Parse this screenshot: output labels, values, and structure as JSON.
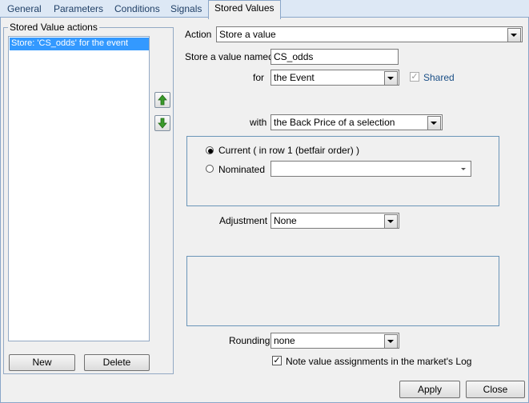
{
  "tabs": [
    {
      "label": "General"
    },
    {
      "label": "Parameters"
    },
    {
      "label": "Conditions"
    },
    {
      "label": "Signals"
    },
    {
      "label": "Stored Values"
    }
  ],
  "stored_actions": {
    "legend": "Stored Value actions",
    "items": [
      "Store: 'CS_odds' for the event"
    ],
    "new_label": "New",
    "delete_label": "Delete"
  },
  "form": {
    "action_label": "Action",
    "action_value": "Store a value",
    "store_named_label": "Store a value named",
    "store_named_value": "CS_odds",
    "for_label": "for",
    "for_value": "the Event",
    "shared_label": "Shared",
    "shared_checked": true,
    "with_label": "with",
    "with_value": "the Back Price of a selection",
    "current_label": "Current ( in row 1 (betfair order) )",
    "nominated_label": "Nominated",
    "nominated_value": "",
    "adjustment_label": "Adjustment",
    "adjustment_value": "None",
    "rounding_label": "Rounding",
    "rounding_value": "none",
    "note_label": "Note value assignments in the market's Log",
    "note_checked": true
  },
  "footer": {
    "apply_label": "Apply",
    "close_label": "Close"
  },
  "icons": {
    "up": "arrow-up-icon",
    "down": "arrow-down-icon"
  },
  "colors": {
    "selection": "#3399ff",
    "tab_bar": "#dde8f5",
    "arrow_green": "#3a9a2a"
  }
}
